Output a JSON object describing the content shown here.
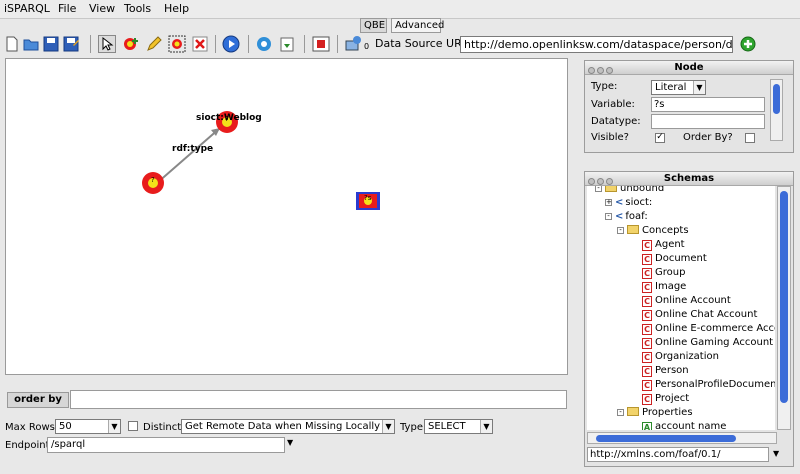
{
  "menu": [
    "iSPARQL",
    "File",
    "View",
    "Tools",
    "Help"
  ],
  "tabs": [
    "QBE",
    "Advanced"
  ],
  "toolbar": {
    "data_source_label": "Data Source URI",
    "data_source_value": "http://demo.openlinksw.com/dataspace/person/dem",
    "zero_badge": "0"
  },
  "graph": {
    "edge_label": "rdf:type",
    "node_label": "sioct:Weblog",
    "node_glyph_1": "?",
    "node_glyph_2": "?",
    "node_glyph_3": "?s"
  },
  "orderby": {
    "label": "order by",
    "value": ""
  },
  "options": {
    "max_rows_label": "Max Rows",
    "max_rows_value": "50",
    "distinct_label": "Distinct",
    "remote_value": "Get Remote Data when Missing Locally",
    "type_label": "Type",
    "type_value": "SELECT",
    "endpoint_label": "Endpoint",
    "endpoint_value": "/sparql"
  },
  "node_panel": {
    "title": "Node",
    "type_label": "Type:",
    "type_value": "Literal",
    "variable_label": "Variable:",
    "variable_value": "?s",
    "datatype_label": "Datatype:",
    "datatype_value": "",
    "visible_label": "Visible?",
    "orderby_label": "Order By?",
    "visible_checked": true,
    "orderby_checked": false
  },
  "schemas_panel": {
    "title": "Schemas",
    "root": "unbound",
    "namespaces": [
      "sioct:",
      "foaf:"
    ],
    "concepts_label": "Concepts",
    "concepts": [
      "Agent",
      "Document",
      "Group",
      "Image",
      "Online Account",
      "Online Chat Account",
      "Online E-commerce Acco",
      "Online Gaming Account",
      "Organization",
      "Person",
      "PersonalProfileDocument",
      "Project"
    ],
    "properties_label": "Properties",
    "properties": [
      "account name"
    ],
    "uri_value": "http://xmlns.com/foaf/0.1/"
  }
}
